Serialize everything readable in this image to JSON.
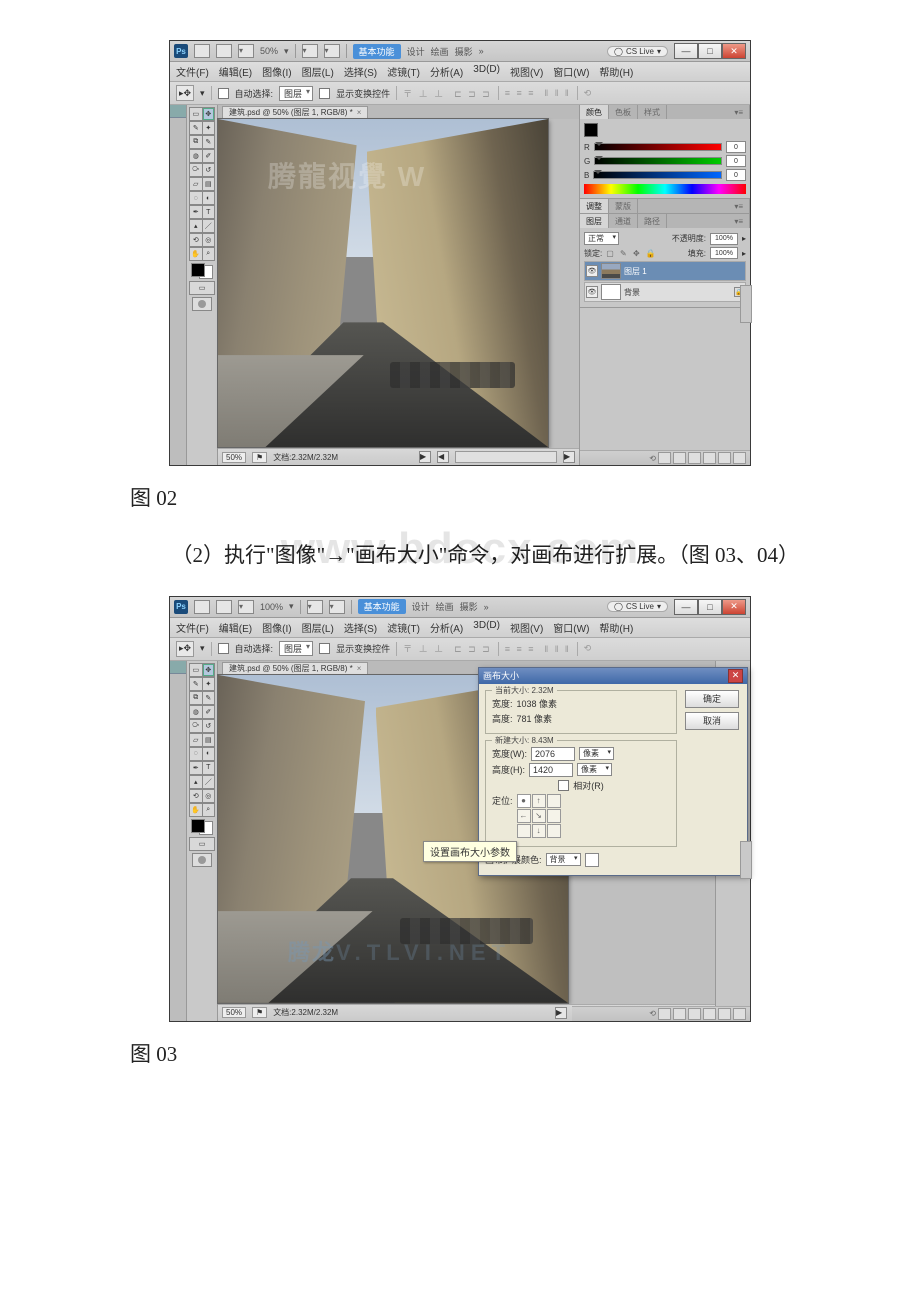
{
  "captions": {
    "fig02": "图 02",
    "fig03": "图 03"
  },
  "body_text": {
    "p1": "（2）执行\"图像\"→\"画布大小\"命令，对画布进行扩展。（图 03、04）"
  },
  "watermarks": {
    "big": "www.bdocx.com",
    "tlvi1": "腾龍视覺 W",
    "tlvi2": "V.TLVI.NET"
  },
  "ps_common": {
    "logo": "Ps",
    "zoom01": "50%",
    "zoom02": "100%",
    "workspace": "基本功能",
    "ws_items": [
      "设计",
      "绘画",
      "摄影",
      "»"
    ],
    "cslive": "CS Live",
    "winbtns": [
      "—",
      "□",
      "✕"
    ],
    "menu": [
      "文件(F)",
      "编辑(E)",
      "图像(I)",
      "图层(L)",
      "选择(S)",
      "滤镜(T)",
      "分析(A)",
      "3D(D)",
      "视图(V)",
      "窗口(W)",
      "帮助(H)"
    ],
    "options": {
      "auto_select": "自动选择:",
      "auto_select_val": "图层",
      "show_transform": "显示变换控件"
    },
    "doc_tab": "建筑.psd @ 50% (图层 1, RGB/8) *",
    "status": {
      "zoom": "50%",
      "docinfo": "文档:2.32M/2.32M"
    },
    "color_panel": {
      "tabs": [
        "颜色",
        "色板",
        "样式"
      ],
      "labels": [
        "R",
        "G",
        "B"
      ],
      "val": "0"
    },
    "adjust_panel": {
      "tabs": [
        "调整",
        "蒙版"
      ]
    },
    "layers_panel": {
      "tabs": [
        "图层",
        "通道",
        "路径"
      ],
      "blend": "正常",
      "opacity_lbl": "不透明度:",
      "opacity_val": "100%",
      "lock_lbl": "锁定:",
      "fill_lbl": "填充:",
      "fill_val": "100%",
      "layers": [
        "图层 1",
        "背景"
      ]
    }
  },
  "canvas_size_dialog": {
    "title": "画布大小",
    "current": {
      "legend": "当前大小: 2.32M",
      "w_lbl": "宽度:",
      "w_val": "1038 像素",
      "h_lbl": "高度:",
      "h_val": "781 像素"
    },
    "new": {
      "legend": "新建大小: 8.43M",
      "w_lbl": "宽度(W):",
      "w_val": "2076",
      "h_lbl": "高度(H):",
      "h_val": "1420",
      "unit": "像素",
      "relative": "相对(R)",
      "anchor_lbl": "定位:"
    },
    "ext_color_lbl": "画布扩展颜色:",
    "ext_color_val": "背景",
    "ok": "确定",
    "cancel": "取消",
    "tooltip": "设置画布大小参数"
  }
}
